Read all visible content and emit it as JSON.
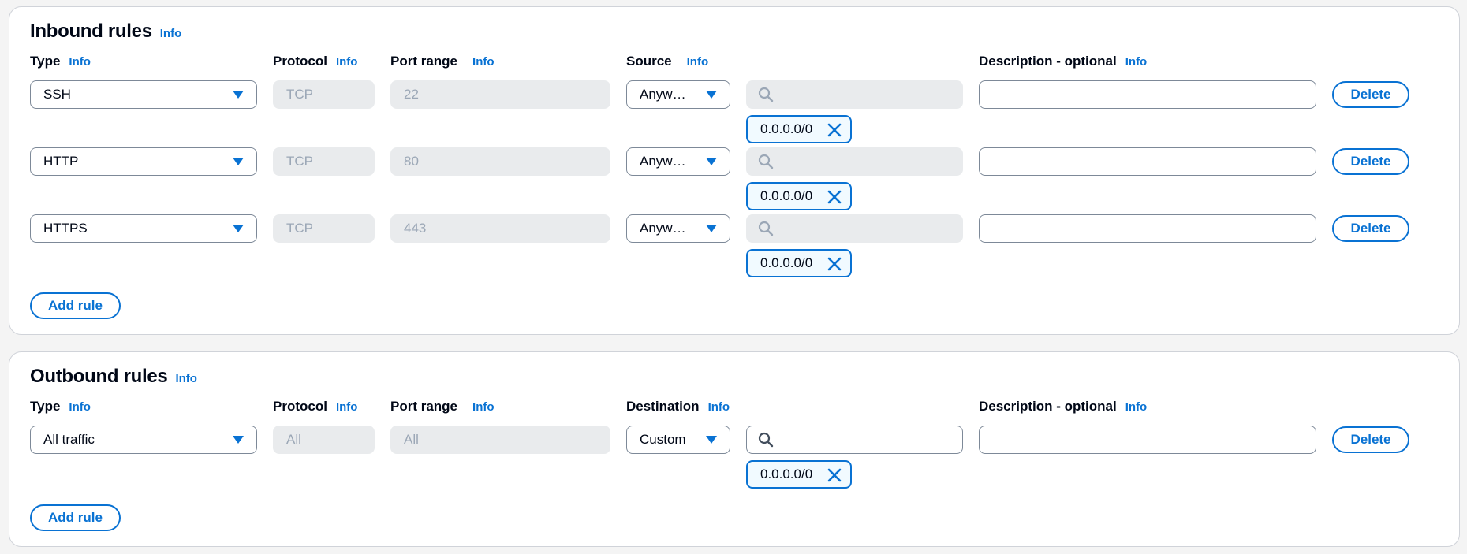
{
  "inbound": {
    "title": "Inbound rules",
    "info": "Info",
    "headers": {
      "type": "Type",
      "protocol": "Protocol",
      "port_range": "Port range",
      "source": "Source",
      "description": "Description - optional",
      "info": "Info"
    },
    "rules": [
      {
        "type": "SSH",
        "protocol": "TCP",
        "port_range": "22",
        "source": "Anyw…",
        "search_value": "",
        "description": "",
        "cidr": "0.0.0.0/0",
        "delete": "Delete"
      },
      {
        "type": "HTTP",
        "protocol": "TCP",
        "port_range": "80",
        "source": "Anyw…",
        "search_value": "",
        "description": "",
        "cidr": "0.0.0.0/0",
        "delete": "Delete"
      },
      {
        "type": "HTTPS",
        "protocol": "TCP",
        "port_range": "443",
        "source": "Anyw…",
        "search_value": "",
        "description": "",
        "cidr": "0.0.0.0/0",
        "delete": "Delete"
      }
    ],
    "add_rule": "Add rule"
  },
  "outbound": {
    "title": "Outbound rules",
    "info": "Info",
    "headers": {
      "type": "Type",
      "protocol": "Protocol",
      "port_range": "Port range",
      "destination": "Destination",
      "description": "Description - optional",
      "info": "Info"
    },
    "rules": [
      {
        "type": "All traffic",
        "protocol": "All",
        "port_range": "All",
        "destination": "Custom",
        "search_value": "",
        "description": "",
        "cidr": "0.0.0.0/0",
        "delete": "Delete"
      }
    ],
    "add_rule": "Add rule"
  },
  "colors": {
    "accent": "#0972d3",
    "disabled_bg": "#e9ebed",
    "disabled_text": "#9ba7b6",
    "border": "#7d8998",
    "token_bg": "#f1faff"
  },
  "icons": {
    "caret": "caret-down-icon",
    "search": "search-icon",
    "dismiss": "close-icon"
  }
}
